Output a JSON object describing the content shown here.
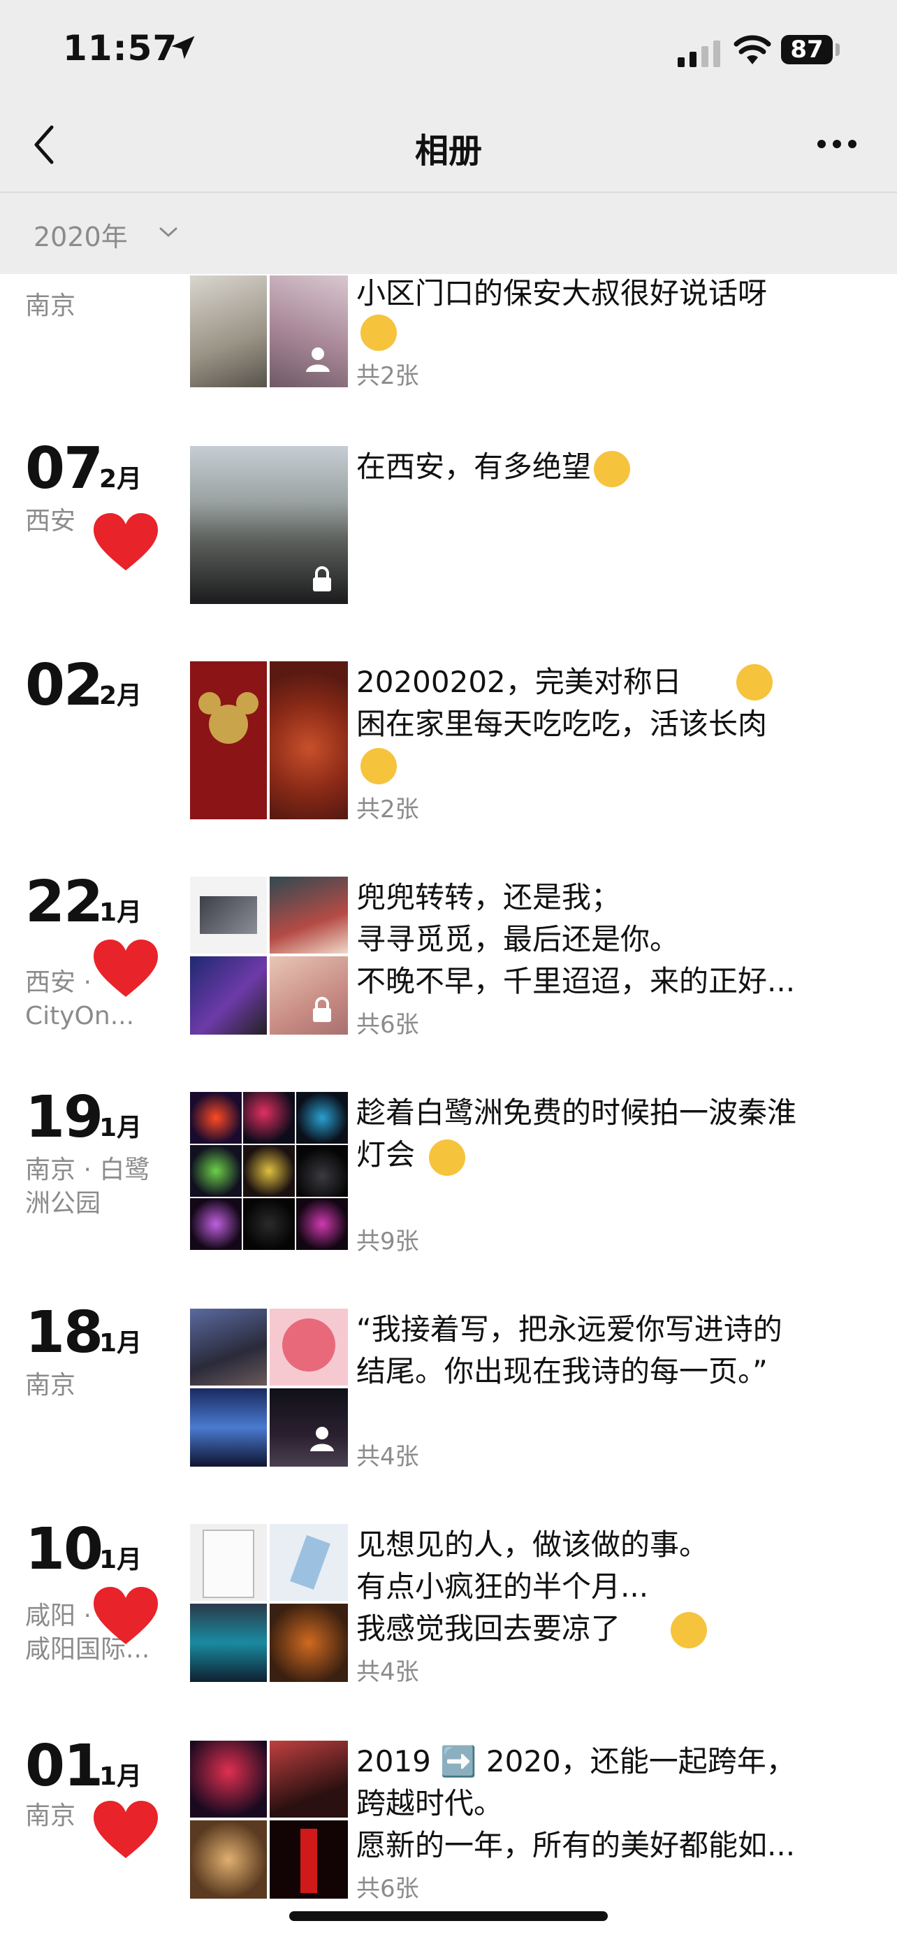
{
  "status": {
    "time": "11:57",
    "battery": "87"
  },
  "nav": {
    "title": "相册"
  },
  "year_filter": {
    "label": "2020年"
  },
  "posts": [
    {
      "day": "",
      "month": "",
      "location": "南京",
      "caption": "小区门口的保安大叔很好说话呀",
      "emoji_line": true,
      "count": "共2张"
    },
    {
      "day": "07",
      "month": "2月",
      "location": "西安",
      "caption": "在西安，有多绝望",
      "count": ""
    },
    {
      "day": "02",
      "month": "2月",
      "location": "",
      "caption": "20200202，完美对称日\n困在家里每天吃吃吃，活该长肉",
      "count": "共2张"
    },
    {
      "day": "22",
      "month": "1月",
      "location": "西安 ·\nCityOn...",
      "caption": "兜兜转转，还是我；\n寻寻觅觅，最后还是你。\n不晚不早，千里迢迢，来的正好...",
      "count": "共6张"
    },
    {
      "day": "19",
      "month": "1月",
      "location": "南京 · 白鹭\n洲公园",
      "caption": "趁着白鹭洲免费的时候拍一波秦淮\n灯会",
      "count": "共9张"
    },
    {
      "day": "18",
      "month": "1月",
      "location": "南京",
      "caption": "“我接着写，把永远爱你写进诗的\n结尾。你出现在我诗的每一页。”",
      "count": "共4张"
    },
    {
      "day": "10",
      "month": "1月",
      "location": "咸阳 ·\n咸阳国际...",
      "caption": "见想见的人，做该做的事。\n有点小疯狂的半个月...\n我感觉我回去要凉了",
      "count": "共4张"
    },
    {
      "day": "01",
      "month": "1月",
      "location": "南京",
      "caption": "2019 ➡️ 2020，还能一起跨年，\n跨越时代。\n愿新的一年，所有的美好都能如...",
      "count": "共6张"
    }
  ],
  "icons": {
    "location": "location-arrow-icon",
    "back": "back-chevron-icon",
    "more": "more-dots-icon",
    "like": "heart-icon",
    "private": "lock-icon",
    "friends": "person-icon"
  },
  "colors": {
    "heart": "#e8232a",
    "muted": "#8b8b8b",
    "chrome": "#ededed"
  }
}
